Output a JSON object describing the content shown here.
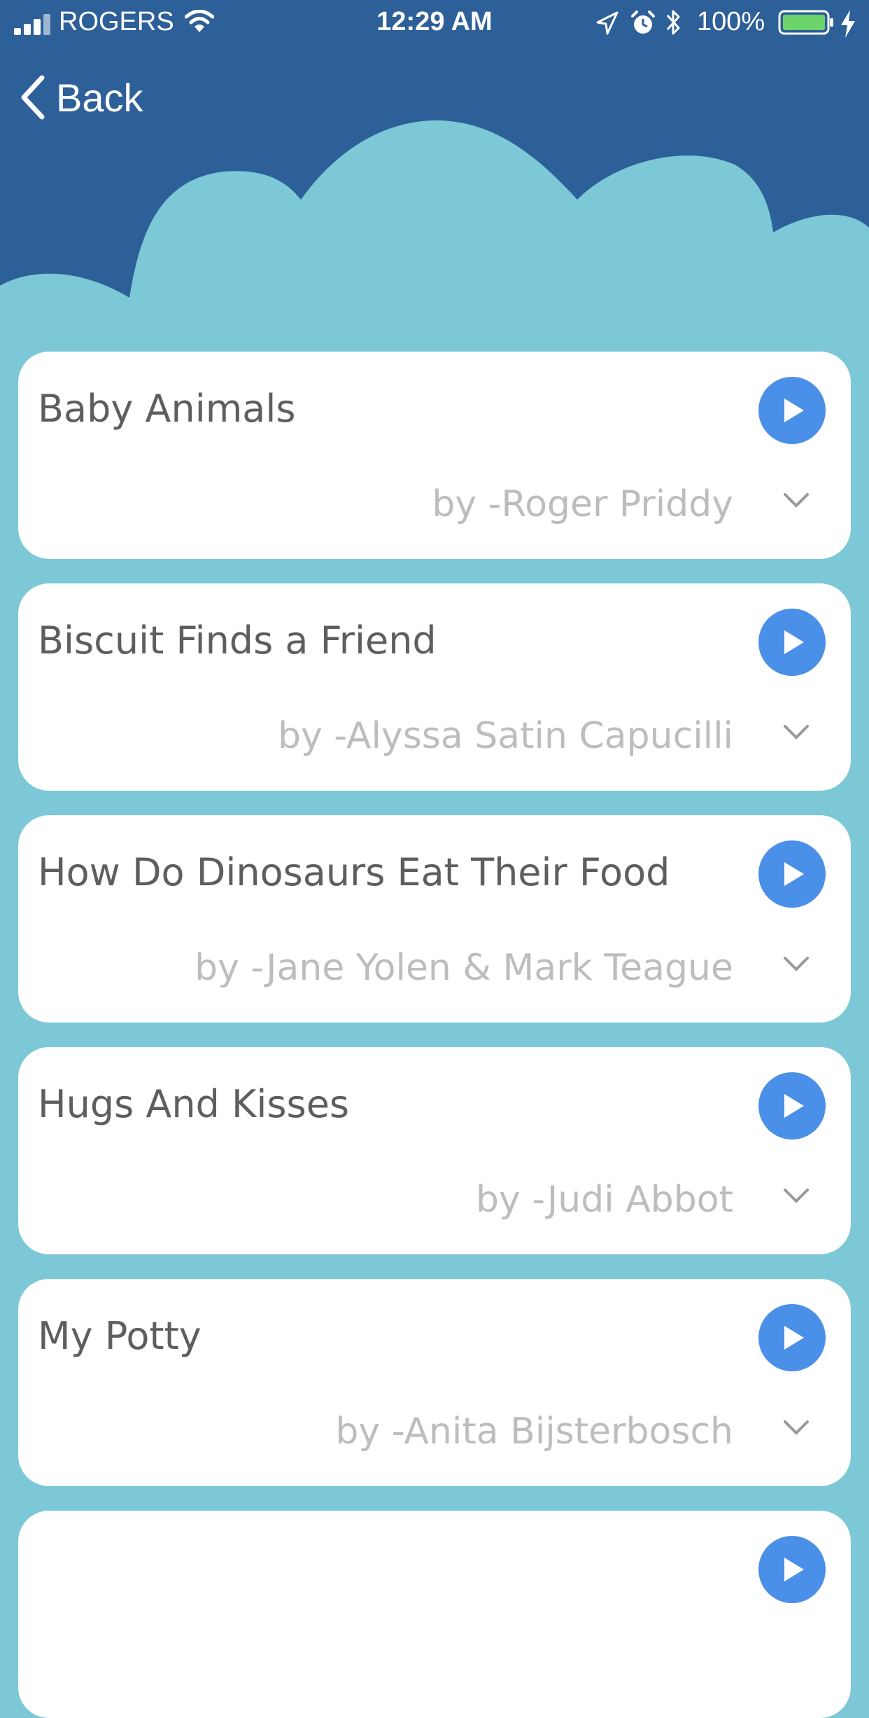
{
  "status_bar": {
    "carrier": "ROGERS",
    "time": "12:29 AM",
    "battery": "100%"
  },
  "nav": {
    "back_label": "Back"
  },
  "colors": {
    "header": "#2d5f98",
    "cloud": "#7cc8d6",
    "play": "#4a8fe8",
    "battery_fill": "#6dd36b"
  },
  "books": [
    {
      "title": "Baby Animals",
      "author": "by -Roger Priddy"
    },
    {
      "title": "Biscuit Finds a Friend",
      "author": "by -Alyssa Satin Capucilli"
    },
    {
      "title": "How Do Dinosaurs Eat Their Food",
      "author": "by -Jane Yolen & Mark Teague"
    },
    {
      "title": "Hugs And Kisses",
      "author": "by -Judi Abbot"
    },
    {
      "title": "My Potty",
      "author": "by -Anita Bijsterbosch"
    }
  ],
  "icons": {
    "play": "play-icon",
    "expand": "chevron-down-icon",
    "back": "chevron-left-icon"
  }
}
